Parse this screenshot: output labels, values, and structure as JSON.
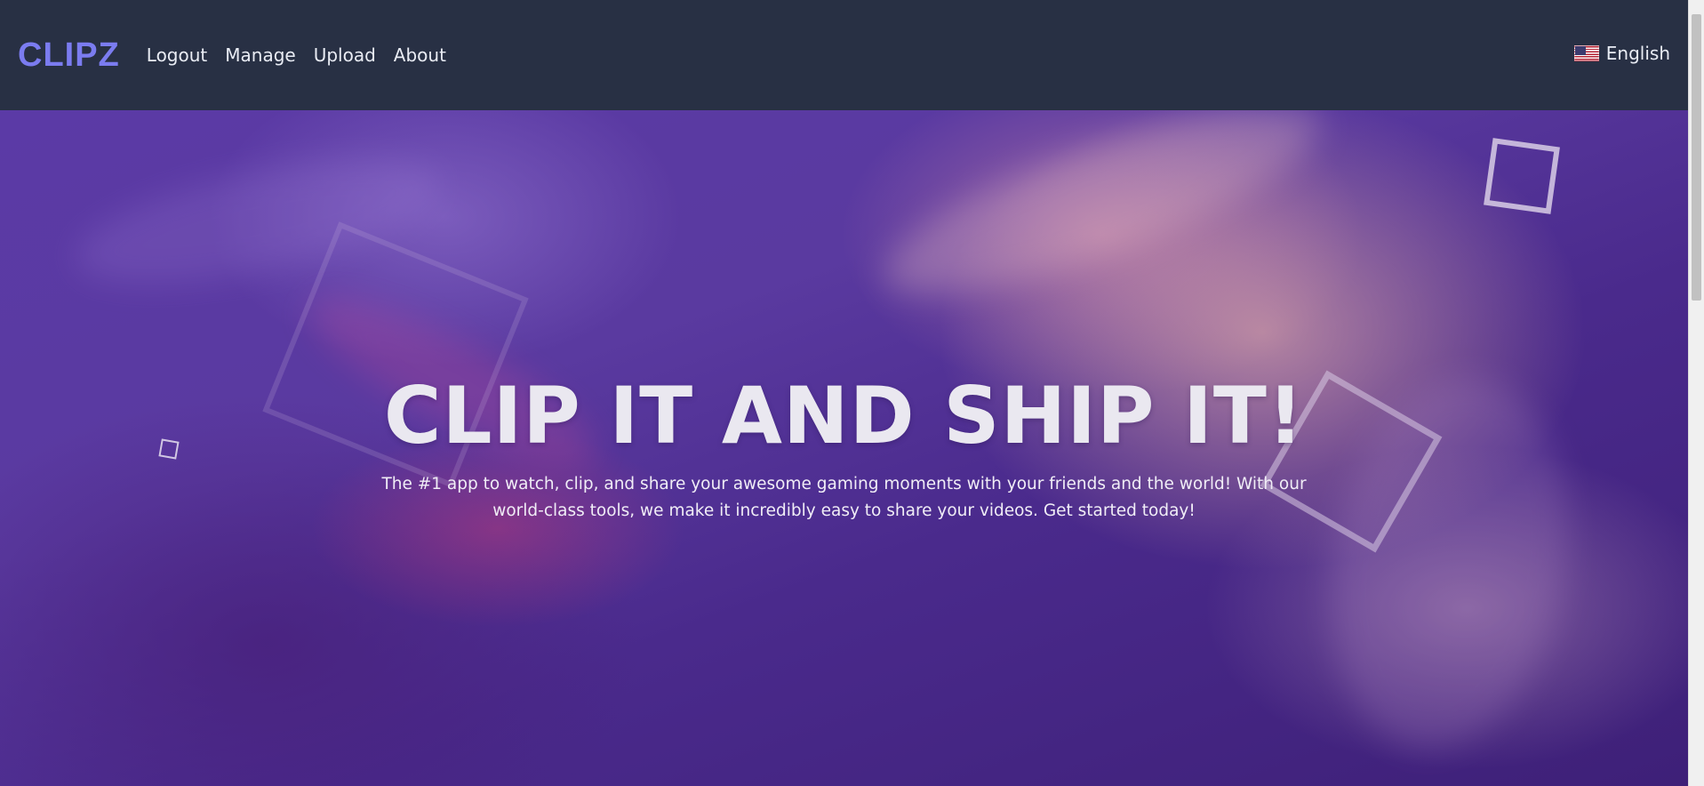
{
  "brand": {
    "name": "CLIPZ"
  },
  "nav": {
    "links": [
      {
        "label": "Logout"
      },
      {
        "label": "Manage"
      },
      {
        "label": "Upload"
      },
      {
        "label": "About"
      }
    ]
  },
  "language": {
    "label": "English",
    "flag_icon": "us-flag-icon"
  },
  "hero": {
    "title": "CLIP IT AND SHIP IT!",
    "subtitle": "The #1 app to watch, clip, and share your awesome gaming moments with your friends and the world! With our world-class tools, we make it incredibly easy to share your videos. Get started today!"
  },
  "colors": {
    "navbar_bg": "#283044",
    "brand": "#7b7cf0",
    "hero_base": "#4a2a8c"
  }
}
